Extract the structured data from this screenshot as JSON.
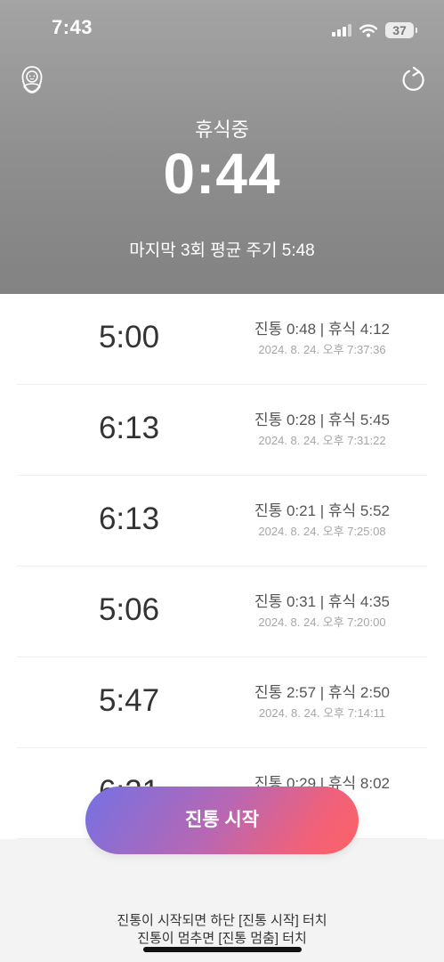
{
  "status_bar": {
    "time": "7:43",
    "battery": "37"
  },
  "header": {
    "status_label": "휴식중",
    "timer": "0:44",
    "average_cycle": "마지막 3회 평균 주기 5:48"
  },
  "records": [
    {
      "cycle": "5:00",
      "summary": "진통 0:48 | 휴식 4:12",
      "timestamp": "2024. 8. 24. 오후 7:37:36"
    },
    {
      "cycle": "6:13",
      "summary": "진통 0:28 | 휴식 5:45",
      "timestamp": "2024. 8. 24. 오후 7:31:22"
    },
    {
      "cycle": "6:13",
      "summary": "진통 0:21 | 휴식 5:52",
      "timestamp": "2024. 8. 24. 오후 7:25:08"
    },
    {
      "cycle": "5:06",
      "summary": "진통 0:31 | 휴식 4:35",
      "timestamp": "2024. 8. 24. 오후 7:20:00"
    },
    {
      "cycle": "5:47",
      "summary": "진통 2:57 | 휴식 2:50",
      "timestamp": "2024. 8. 24. 오후 7:14:11"
    },
    {
      "cycle": "6:21",
      "summary": "진통 0:29 | 휴식 8:02",
      "timestamp": ""
    }
  ],
  "start_button": {
    "label": "진통 시작"
  },
  "help": {
    "line1": "진통이 시작되면 하단 [진통 시작] 터치",
    "line2": "진통이 멈추면 [진통 멈춤] 터치"
  },
  "icons": {
    "left": "baby-icon",
    "right": "reset-icon"
  },
  "colors": {
    "header_bg": "#8e8e8e",
    "button_gradient_start": "#7471e3",
    "button_gradient_end": "#fd6265"
  }
}
